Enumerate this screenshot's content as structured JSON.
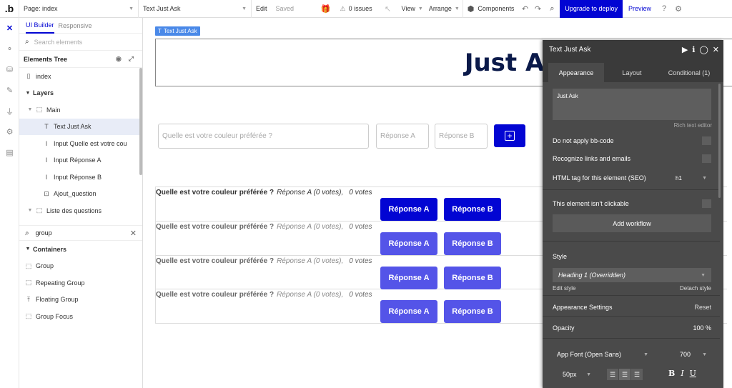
{
  "topbar": {
    "logo": ".b",
    "page_label": "Page: index",
    "element_label": "Text Just Ask",
    "mode_edit": "Edit",
    "mode_saved": "Saved",
    "issues": "0 issues",
    "view": "View",
    "arrange": "Arrange",
    "components": "Components",
    "deploy": "Upgrade to deploy",
    "preview": "Preview"
  },
  "left_panel": {
    "tab_builder": "UI Builder",
    "tab_responsive": "Responsive",
    "search_placeholder": "Search elements",
    "tree_title": "Elements Tree",
    "tree_items": [
      {
        "label": "index",
        "icon": "page-icon"
      },
      {
        "label": "Layers",
        "icon": "triangle-down"
      },
      {
        "label": "Main",
        "icon": "group-icon"
      },
      {
        "label": "Text Just Ask",
        "icon": "text-icon"
      },
      {
        "label": "Input Quelle est votre cou",
        "icon": "input-icon"
      },
      {
        "label": "Input Réponse A",
        "icon": "input-icon"
      },
      {
        "label": "Input Réponse B",
        "icon": "input-icon"
      },
      {
        "label": "Ajout_question",
        "icon": "button-icon"
      },
      {
        "label": "Liste des questions",
        "icon": "repeating-group-icon"
      }
    ],
    "filter_value": "group",
    "containers_title": "Containers",
    "containers": [
      {
        "label": "Group",
        "icon": "group-icon"
      },
      {
        "label": "Repeating Group",
        "icon": "repeating-group-icon"
      },
      {
        "label": "Floating Group",
        "icon": "floating-group-icon"
      },
      {
        "label": "Group Focus",
        "icon": "group-focus-icon"
      }
    ]
  },
  "canvas": {
    "selected_label": "Text Just Ask",
    "title": "Just Ask",
    "question_placeholder": "Quelle est votre couleur préférée ?",
    "answer_a_placeholder": "Réponse A",
    "answer_b_placeholder": "Réponse B",
    "rows": [
      {
        "question": "Quelle est votre couleur préférée ?",
        "answer": "Réponse A (0 votes),",
        "count": "0 votes",
        "btn_a": "Réponse A",
        "btn_b": "Réponse B"
      },
      {
        "question": "Quelle est votre couleur préférée ?",
        "answer": "Réponse A (0 votes),",
        "count": "0 votes",
        "btn_a": "Réponse A",
        "btn_b": "Réponse B"
      },
      {
        "question": "Quelle est votre couleur préférée ?",
        "answer": "Réponse A (0 votes),",
        "count": "0 votes",
        "btn_a": "Réponse A",
        "btn_b": "Réponse B"
      },
      {
        "question": "Quelle est votre couleur préférée ?",
        "answer": "Réponse A (0 votes),",
        "count": "0 votes",
        "btn_a": "Réponse A",
        "btn_b": "Réponse B"
      }
    ]
  },
  "property_editor": {
    "title": "Text Just Ask",
    "tabs": [
      "Appearance",
      "Layout",
      "Conditional (1)"
    ],
    "text_value": "Just Ask",
    "rich_text": "Rich text editor",
    "no_bbcode": "Do not apply bb-code",
    "recognize_links": "Recognize links and emails",
    "html_tag_label": "HTML tag for this element (SEO)",
    "html_tag_value": "h1",
    "not_clickable": "This element isn't clickable",
    "add_workflow": "Add workflow",
    "style_label": "Style",
    "style_value": "Heading 1 (Overridden)",
    "edit_style": "Edit style",
    "detach_style": "Detach style",
    "appearance_settings": "Appearance Settings",
    "reset": "Reset",
    "opacity_label": "Opacity",
    "opacity_value": "100 %",
    "font": "App Font (Open Sans)",
    "weight": "700",
    "size": "50px"
  },
  "colors": {
    "accent": "#0205d3",
    "button_light": "#5454e8",
    "panel_dark": "#4a4a4a"
  }
}
